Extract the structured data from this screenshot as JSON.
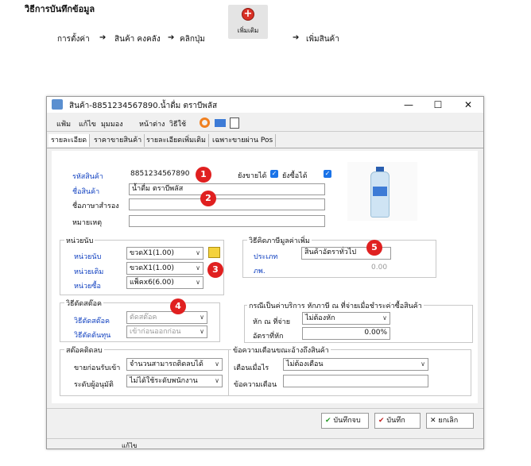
{
  "doc": {
    "title": "วิธีการบันทึกข้อมูล",
    "step_prefix": "การตั้งค่า",
    "step_a": "สินค้า คงคลัง",
    "step_b": "คลิกปุ่ม",
    "step_c": "เพิ่มสินค้า",
    "add_button_label": "เพิ่มเติม"
  },
  "window": {
    "title": "สินค้า-8851234567890.น้ำดื่ม ตราบีพลัส",
    "menu": [
      "แฟ้ม",
      "แก้ไข",
      "มุมมอง",
      "หน้าต่าง",
      "วิธีใช้"
    ],
    "tabs": [
      "รายละเอียด",
      "ราคาขายสินค้า",
      "รายละเอียดเพิ่มเติม",
      "เฉพาะขายผ่าน Pos"
    ]
  },
  "details": {
    "code_label": "รหัสสินค้า",
    "code_value": "8851234567890",
    "name_label": "ชื่อสินค้า",
    "name_value": "น้ำดื่ม ตราบีพลัส",
    "alt_name_label": "ชื่อภาษาสำรอง",
    "alt_name_value": "",
    "note_label": "หมายเหตุ",
    "note_value": "",
    "can_sell_label": "ยังขายได้",
    "can_buy_label": "ยังซื้อได้"
  },
  "units": {
    "group_title": "หน่วยนับ",
    "unit_label": "หน่วยนับ",
    "unit_value": "ขวดX1(1.00)",
    "std_label": "หน่วยเติม",
    "std_value": "ขวดX1(1.00)",
    "buy_label": "หน่วยซื้อ",
    "buy_value": "แพ็คx6(6.00)"
  },
  "vat": {
    "group_title": "วิธีคิดภาษีมูลค่าเพิ่ม",
    "type_label": "ประเภท",
    "type_value": "สินค้าอัตราทั่วไป",
    "rate_label": "ภพ.",
    "rate_value": "0.00"
  },
  "cost": {
    "group_title": "วิธีตัดสต๊อค",
    "cut_label": "วิธีตัดสต๊อค",
    "cut_value": "ตัดสต๊อค",
    "cost_label": "วิธีตัดต้นทุน",
    "cost_value": "เข้าก่อนออกก่อน"
  },
  "service": {
    "group_title": "กรณีเป็นค่าบริการ หักภาษี ณ ที่จ่ายเมื่อชำระค่าซื้อสินค้า",
    "wht_label": "หัก ณ ที่จ่าย",
    "wht_value": "ไม่ต้องหัก",
    "rate_label": "อัตราที่หัก",
    "rate_value": "0.00%"
  },
  "negstock": {
    "group_title": "สต๊อคติดลบ",
    "sell_label": "ขายก่อนรับเข้า",
    "sell_value": "จำนวนสามารถติดลบได้",
    "approve_label": "ระดับผู้อนุมัติ",
    "approve_value": "ไม่ได้ใช้ระดับพนักงาน"
  },
  "alert": {
    "group_title": "ข้อความเตือนขณะอ้างถึงสินค้า",
    "when_label": "เตือนเมื่อไร",
    "when_value": "ไม่ต้องเตือน",
    "msg_label": "ข้อความเตือน",
    "msg_value": ""
  },
  "buttons": {
    "save_close": "บันทึกจบ",
    "save": "บันทึก",
    "cancel": "ยกเลิก"
  },
  "status": {
    "text": "แก้ไข"
  },
  "badges": [
    "1",
    "2",
    "3",
    "4",
    "5"
  ],
  "colors": {
    "label_blue": "#1040c0",
    "badge_red": "#e02020",
    "checkbox_blue": "#1a73e8"
  }
}
